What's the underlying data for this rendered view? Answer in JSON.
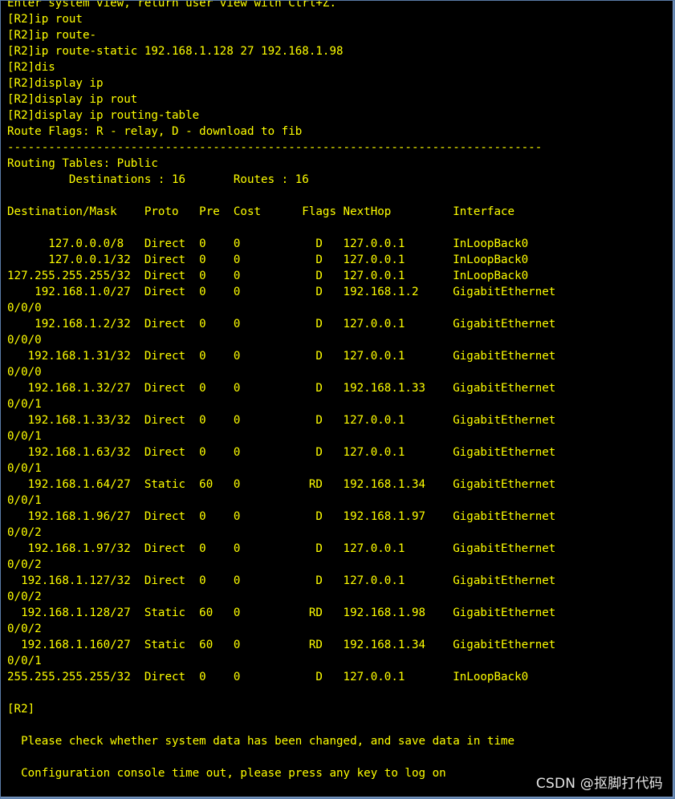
{
  "terminal": {
    "prompt": "[R2]",
    "lines": [
      "Enter system view, return user view with Ctrl+Z.",
      "[R2]ip rout",
      "[R2]ip route-",
      "[R2]ip route-static 192.168.1.128 27 192.168.1.98",
      "[R2]dis",
      "[R2]display ip",
      "[R2]display ip rout",
      "[R2]display ip routing-table",
      "Route Flags: R - relay, D - download to fib",
      "------------------------------------------------------------------------------",
      "Routing Tables: Public",
      "         Destinations : 16       Routes : 16",
      "",
      "Destination/Mask    Proto   Pre  Cost      Flags NextHop         Interface",
      "",
      "      127.0.0.0/8   Direct  0    0           D   127.0.0.1       InLoopBack0",
      "      127.0.0.1/32  Direct  0    0           D   127.0.0.1       InLoopBack0",
      "127.255.255.255/32  Direct  0    0           D   127.0.0.1       InLoopBack0",
      "    192.168.1.0/27  Direct  0    0           D   192.168.1.2     GigabitEthernet",
      "0/0/0",
      "    192.168.1.2/32  Direct  0    0           D   127.0.0.1       GigabitEthernet",
      "0/0/0",
      "   192.168.1.31/32  Direct  0    0           D   127.0.0.1       GigabitEthernet",
      "0/0/0",
      "   192.168.1.32/27  Direct  0    0           D   192.168.1.33    GigabitEthernet",
      "0/0/1",
      "   192.168.1.33/32  Direct  0    0           D   127.0.0.1       GigabitEthernet",
      "0/0/1",
      "   192.168.1.63/32  Direct  0    0           D   127.0.0.1       GigabitEthernet",
      "0/0/1",
      "   192.168.1.64/27  Static  60   0          RD   192.168.1.34    GigabitEthernet",
      "0/0/1",
      "   192.168.1.96/27  Direct  0    0           D   192.168.1.97    GigabitEthernet",
      "0/0/2",
      "   192.168.1.97/32  Direct  0    0           D   127.0.0.1       GigabitEthernet",
      "0/0/2",
      "  192.168.1.127/32  Direct  0    0           D   127.0.0.1       GigabitEthernet",
      "0/0/2",
      "  192.168.1.128/27  Static  60   0          RD   192.168.1.98    GigabitEthernet",
      "0/0/2",
      "  192.168.1.160/27  Static  60   0          RD   192.168.1.34    GigabitEthernet",
      "0/0/1",
      "255.255.255.255/32  Direct  0    0           D   127.0.0.1       InLoopBack0",
      "",
      "[R2]",
      "",
      "  Please check whether system data has been changed, and save data in time",
      "",
      "  Configuration console time out, please press any key to log on"
    ]
  },
  "watermark": {
    "text": "CSDN @抠脚打代码"
  },
  "colors": {
    "background": "#000000",
    "text": "#ffff00",
    "watermark": "#e6e6e6",
    "frame_border": "#5a7ca8"
  }
}
